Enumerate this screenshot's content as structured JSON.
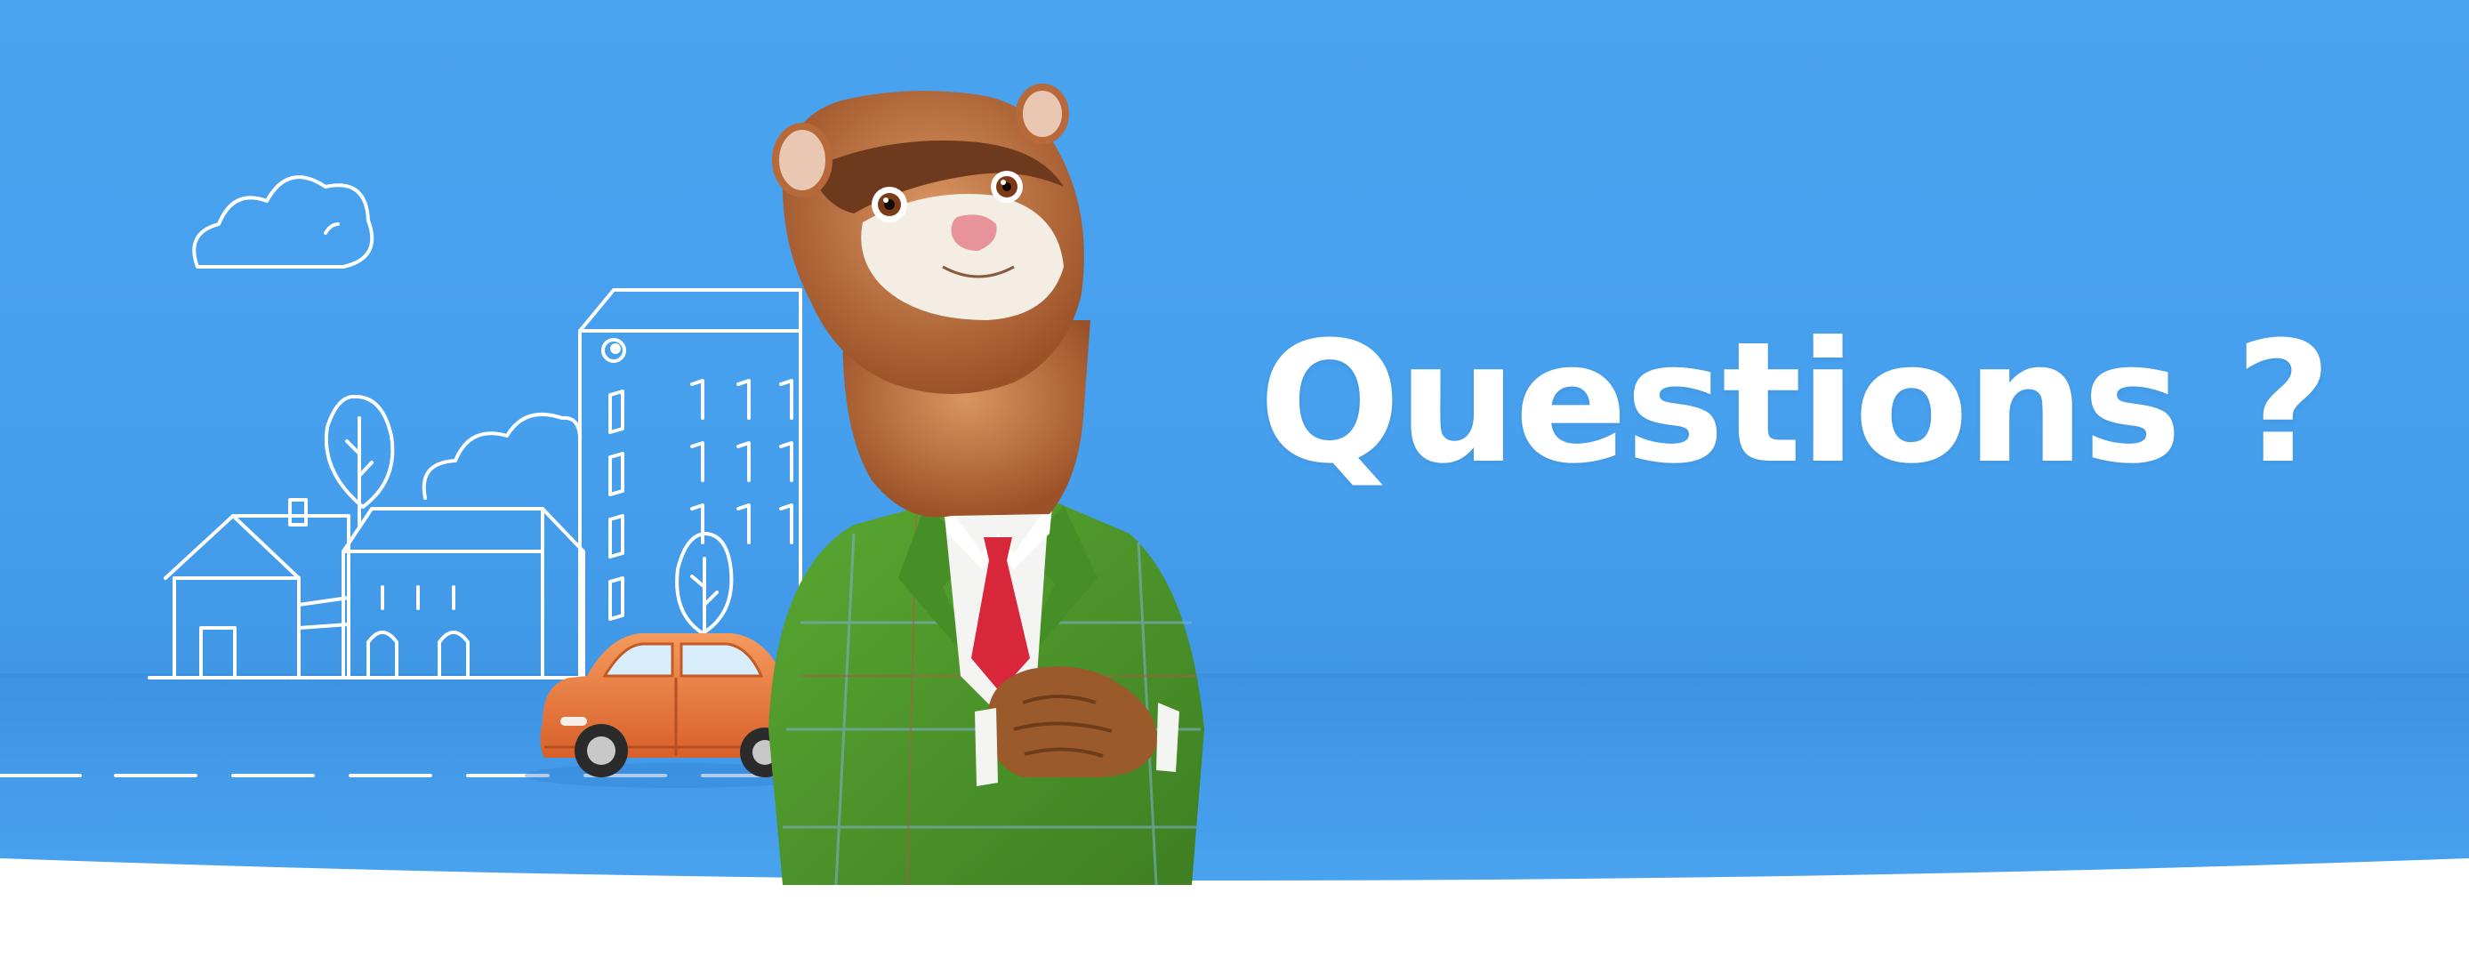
{
  "hero": {
    "headline": "Questions ?",
    "colors": {
      "sky": "#4aa3ef",
      "ground": "#3f97e6",
      "outline": "#ffffff",
      "car": "#f07a3c",
      "suit": "#4e9a2b",
      "tie": "#d8263a",
      "fur": "#b8693a",
      "page_background": "#ffffff"
    },
    "illustration": {
      "mascot": "ferret-in-green-suit",
      "vehicle": "orange-vintage-car",
      "sketch": "white-outline-town"
    }
  }
}
